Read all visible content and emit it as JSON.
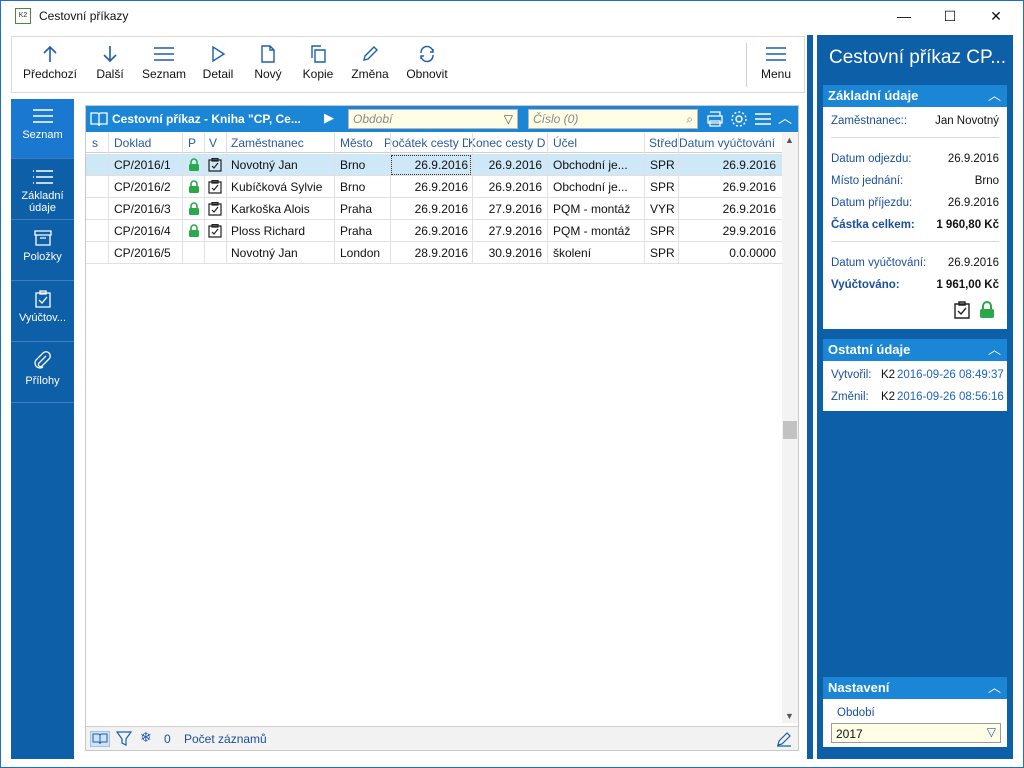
{
  "window": {
    "title": "Cestovní příkazy",
    "minimize": "—",
    "maximize": "☐",
    "close": "✕"
  },
  "toolbar": {
    "previous": "Předchozí",
    "next": "Další",
    "list": "Seznam",
    "detail": "Detail",
    "new": "Nový",
    "copy": "Kopie",
    "change": "Změna",
    "refresh": "Obnovit",
    "menu": "Menu"
  },
  "leftnav": {
    "items": [
      "Seznam",
      "Základní údaje",
      "Položky",
      "Vyúčtov...",
      "Přílohy"
    ]
  },
  "grid": {
    "title": "Cestovní příkaz - Kniha \"CP, Ce...",
    "period_placeholder": "Období",
    "number_placeholder": "Číslo (0)",
    "columns": [
      "s",
      "Doklad",
      "P",
      "V",
      "Zaměstnanec",
      "Město",
      "Počátek cesty D",
      "Konec cesty D",
      "Účel",
      "Středi",
      "Datum vyúčtování"
    ],
    "rows": [
      {
        "doc": "CP/2016/1",
        "p": true,
        "v": true,
        "emp": "Novotný Jan",
        "city": "Brno",
        "start": "26.9.2016",
        "end": "26.9.2016",
        "purpose": "Obchodní je...",
        "center": "SPR",
        "settle": "26.9.2016"
      },
      {
        "doc": "CP/2016/2",
        "p": true,
        "v": true,
        "emp": "Kubíčková Sylvie",
        "city": "Brno",
        "start": "26.9.2016",
        "end": "26.9.2016",
        "purpose": "Obchodní je...",
        "center": "SPR",
        "settle": "26.9.2016"
      },
      {
        "doc": "CP/2016/3",
        "p": true,
        "v": true,
        "emp": "Karkoška Alois",
        "city": "Praha",
        "start": "26.9.2016",
        "end": "27.9.2016",
        "purpose": "PQM - montáž",
        "center": "VYR",
        "settle": "26.9.2016"
      },
      {
        "doc": "CP/2016/4",
        "p": true,
        "v": true,
        "emp": "Ploss Richard",
        "city": "Praha",
        "start": "26.9.2016",
        "end": "27.9.2016",
        "purpose": "PQM - montáž",
        "center": "SPR",
        "settle": "29.9.2016"
      },
      {
        "doc": "CP/2016/5",
        "p": false,
        "v": false,
        "emp": "Novotný Jan",
        "city": "London",
        "start": "28.9.2016",
        "end": "30.9.2016",
        "purpose": "školení",
        "center": "SPR",
        "settle": "0.0.0000"
      }
    ],
    "status": {
      "count_label": "0",
      "records_label": "Počet záznamů"
    }
  },
  "right": {
    "title": "Cestovní příkaz CP...",
    "basic": {
      "header": "Základní údaje",
      "employee_label": "Zaměstnanec::",
      "employee": "Jan Novotný",
      "departure_label": "Datum odjezdu:",
      "departure": "26.9.2016",
      "place_label": "Místo jednání:",
      "place": "Brno",
      "arrival_label": "Datum příjezdu:",
      "arrival": "26.9.2016",
      "total_label": "Částka celkem:",
      "total": "1 960,80 Kč",
      "settle_date_label": "Datum vyúčtování:",
      "settle_date": "26.9.2016",
      "settled_label": "Vyúčtováno:",
      "settled": "1 961,00 Kč"
    },
    "other": {
      "header": "Ostatní údaje",
      "created_label": "Vytvořil:",
      "created_user": "K2",
      "created_at": "2016-09-26 08:49:37",
      "changed_label": "Změnil:",
      "changed_user": "K2",
      "changed_at": "2016-09-26 08:56:16"
    },
    "settings": {
      "header": "Nastavení",
      "period_label": "Období",
      "period_value": "2017"
    }
  }
}
